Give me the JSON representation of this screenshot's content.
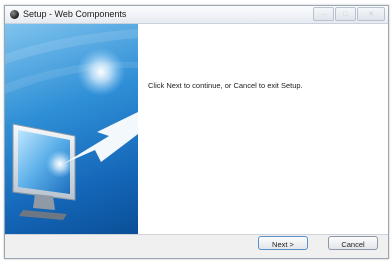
{
  "window": {
    "title": "Setup - Web Components"
  },
  "titlebar": {
    "minimize_glyph": "–",
    "maximize_glyph": "□",
    "close_glyph": "✕"
  },
  "main": {
    "message": "Click Next to continue, or Cancel to exit Setup."
  },
  "footer": {
    "next_label": "Next >",
    "cancel_label": "Cancel"
  },
  "colors": {
    "banner_blue": "#1466b8",
    "accent_button_border": "#5b8fc7"
  },
  "icons": [
    "setup-app-icon",
    "computer-monitor-icon",
    "arrow-icon"
  ]
}
